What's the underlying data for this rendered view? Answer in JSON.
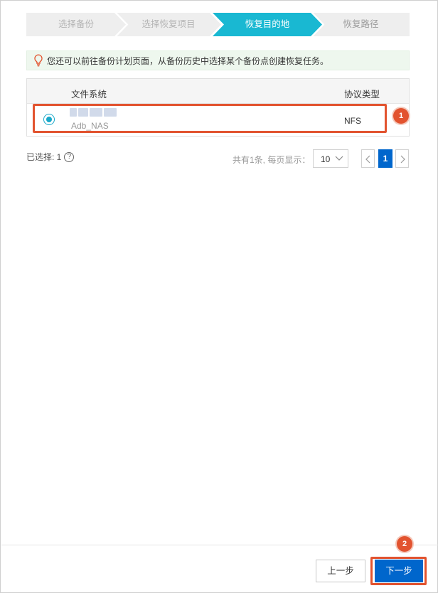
{
  "steps": [
    {
      "label": "选择备份",
      "state": "done"
    },
    {
      "label": "选择恢复项目",
      "state": "done"
    },
    {
      "label": "恢复目的地",
      "state": "active"
    },
    {
      "label": "恢复路径",
      "state": "todo"
    }
  ],
  "tip": {
    "icon": "lightbulb-icon",
    "text": "您还可以前往备份计划页面，从备份历史中选择某个备份点创建恢复任务。"
  },
  "table": {
    "columns": [
      "文件系统",
      "协议类型"
    ],
    "rows": [
      {
        "selected": true,
        "fs_name": "Adb_NAS",
        "protocol": "NFS"
      }
    ]
  },
  "selection": {
    "label": "已选择: 1"
  },
  "pagination": {
    "total_text": "共有1条, 每页显示：",
    "page_size": "10",
    "current_page": "1"
  },
  "buttons": {
    "prev": "上一步",
    "next": "下一步"
  },
  "annotations": {
    "badge1": "1",
    "badge2": "2"
  },
  "colors": {
    "accent": "#19a8c9",
    "primary": "#0066cc",
    "annotation": "#e2532f",
    "step_inactive": "#eeeeee"
  }
}
